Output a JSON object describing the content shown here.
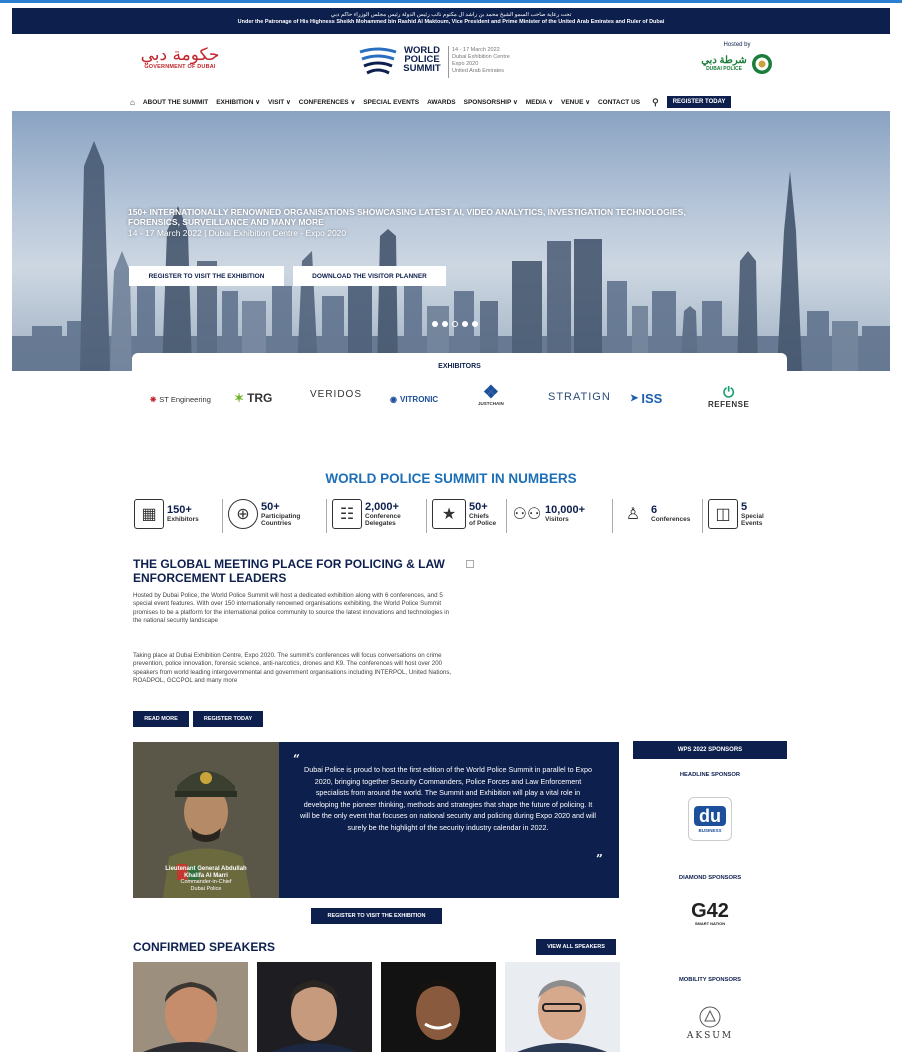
{
  "topbar": {
    "arabic": "تحت رعاية صاحب السمو الشيخ محمد بن راشد آل مكتوم نائب رئيس الدولة رئيس مجلس الوزراء حاكم دبي",
    "english": "Under the Patronage of His Highness Sheikh Mohammed bin Rashid Al Maktoum, Vice President and Prime Minister of the United Arab Emirates and Ruler of Dubai"
  },
  "header": {
    "gov_logo_ar": "حكومة دبي",
    "gov_logo_en": "GOVERNMENT OF DUBAI",
    "wps_logo": [
      "WORLD",
      "POLICE",
      "SUMMIT"
    ],
    "wps_info": [
      "14 - 17 March 2022",
      "Dubai Exhibition Centre",
      "Expo 2020",
      "United Arab Emirates"
    ],
    "hosted_by": "Hosted by",
    "dubai_police_ar": "شرطة دبي",
    "dubai_police_en": "DUBAI POLICE"
  },
  "nav": {
    "items": [
      "ABOUT THE SUMMIT",
      "EXHIBITION ∨",
      "VISIT ∨",
      "CONFERENCES ∨",
      "SPECIAL EVENTS",
      "AWARDS",
      "SPONSORSHIP ∨",
      "MEDIA ∨",
      "VENUE ∨",
      "CONTACT US"
    ],
    "register": "REGISTER TODAY",
    "icons": [
      "home-icon",
      "search-icon"
    ]
  },
  "hero": {
    "headline": "150+ INTERNATIONALLY RENOWNED ORGANISATIONS SHOWCASING LATEST AI, VIDEO ANALYTICS, INVESTIGATION TECHNOLOGIES, FORENSICS, SURVEILLANCE AND MANY MORE",
    "dates": "14 - 17 March 2022 | Dubai Exhibition Centre - Expo 2020",
    "btn_register": "REGISTER TO VISIT THE EXHIBITION",
    "btn_planner": "DOWNLOAD THE VISITOR PLANNER",
    "slides_total": 5,
    "slide_active": 3
  },
  "exhibitors": {
    "title": "EXHIBITORS",
    "logos": [
      "ST Engineering",
      "TRG",
      "VERIDOS",
      "VITRONIC",
      "JUSTCHAIN",
      "STRATIGN",
      "ISS",
      "REFENSE"
    ]
  },
  "numbers": {
    "title": "WORLD POLICE SUMMIT IN NUMBERS",
    "items": [
      {
        "value": "150+",
        "label1": "Exhibitors",
        "label2": ""
      },
      {
        "value": "50+",
        "label1": "Participating",
        "label2": "Countries"
      },
      {
        "value": "2,000+",
        "label1": "Conference",
        "label2": "Delegates"
      },
      {
        "value": "50+",
        "label1": "Chiefs",
        "label2": "of Police"
      },
      {
        "value": "10,000+",
        "label1": "Visitors",
        "label2": ""
      },
      {
        "value": "6",
        "label1": "Conferences",
        "label2": ""
      },
      {
        "value": "5",
        "label1": "Special",
        "label2": "Events"
      }
    ]
  },
  "about": {
    "title": "THE GLOBAL MEETING PLACE FOR POLICING & LAW ENFORCEMENT LEADERS",
    "para1": "Hosted by Dubai Police, the World Police Summit will host a dedicated exhibition along with 6 conferences, and 5 special event features. With over 150 internationally renowned organisations exhibiting, the World Police Summit promises to be a platform for the international police community to source the latest innovations and technologies in the national security landscape",
    "para2": "Taking place at Dubai Exhibition Centre, Expo 2020. The summit's conferences will focus conversations on crime prevention, police innovation, forensic science, anti-narcotics, drones and K9. The conferences will host over 200 speakers from world leading intergovernmental and government organisations including INTERPOL, United Nations, ROADPOL, GCCPOL and many more",
    "read_more": "READ MORE",
    "register": "REGISTER TODAY"
  },
  "quote": {
    "text": "Dubai Police is proud to host the first edition of the World Police Summit in parallel to Expo 2020, bringing together Security Commanders, Police Forces and Law Enforcement specialists from around the world. The Summit and Exhibition will play a vital role in developing the pioneer thinking, methods and strategies that shape the future of policing. It will be the only event that focuses on national security and policing during Expo 2020 and will surely be the highlight of the security industry calendar in 2022.",
    "name1": "Lieutenant General Abdullah",
    "name2": "Khalifa Al Marri",
    "role1": "Commander-in-Chief",
    "role2": "Dubai Police",
    "cta": "REGISTER TO VISIT THE EXHIBITION"
  },
  "sponsors": {
    "header": "WPS 2022 SPONSORS",
    "headline_label": "HEADLINE SPONSOR",
    "headline_logo": "du",
    "headline_logo_sub": "BUSINESS",
    "diamond_label": "DIAMOND SPONSORS",
    "diamond_logo": "G42",
    "diamond_logo_sub": "SMART NATION",
    "mobility_label": "MOBILITY SPONSORS",
    "mobility_logo": "AKSUM"
  },
  "speakers": {
    "title": "CONFIRMED SPEAKERS",
    "view_all": "VIEW ALL SPEAKERS"
  },
  "colors": {
    "navy": "#0d1f4d",
    "accent_blue": "#1d6fb8",
    "gov_red": "#c0262d",
    "police_green": "#1a7d3a"
  }
}
